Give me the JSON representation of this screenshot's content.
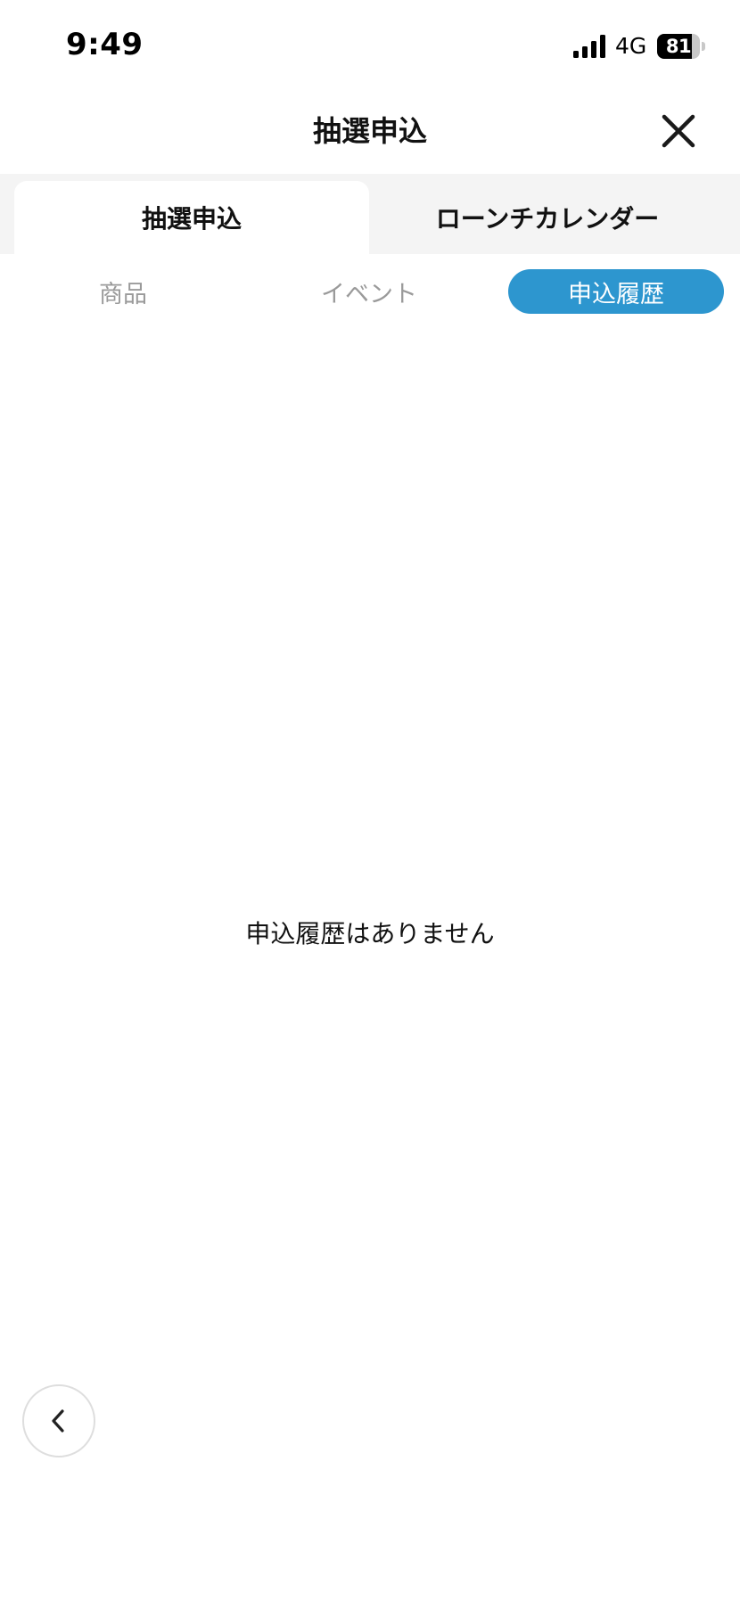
{
  "status_bar": {
    "time": "9:49",
    "network": "4G",
    "battery_level": "81",
    "battery_percent": 81,
    "icons": [
      "signal-bars-icon",
      "battery-icon"
    ]
  },
  "header": {
    "title": "抽選申込",
    "close_icon": "close-icon"
  },
  "primary_tabs": [
    {
      "label": "抽選申込",
      "active": true
    },
    {
      "label": "ローンチカレンダー",
      "active": false
    }
  ],
  "secondary_tabs": [
    {
      "label": "商品",
      "active": false
    },
    {
      "label": "イベント",
      "active": false
    },
    {
      "label": "申込履歴",
      "active": true
    }
  ],
  "empty_state": {
    "message": "申込履歴はありません"
  },
  "back_button": {
    "icon": "chevron-left-icon"
  },
  "colors": {
    "accent": "#2d96cf",
    "tab_bar_bg": "#f4f4f4",
    "inactive_text": "#9a9a9a",
    "text": "#111111"
  }
}
